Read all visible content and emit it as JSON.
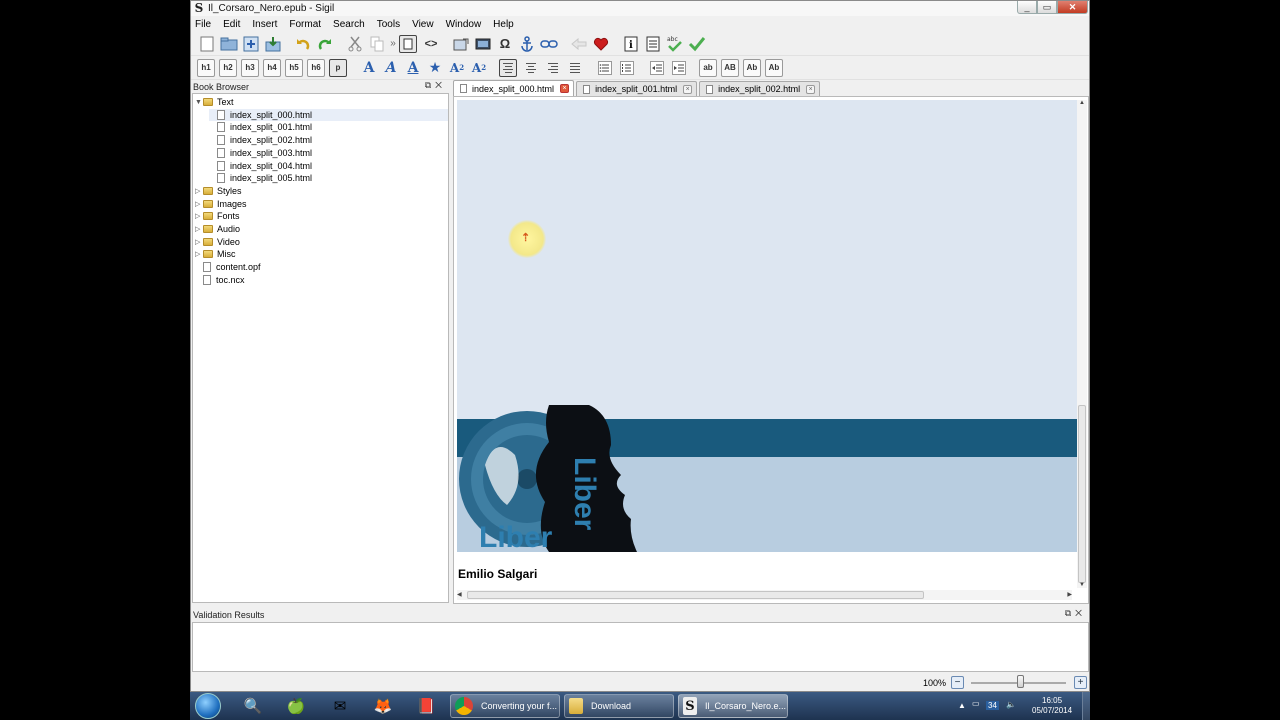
{
  "window": {
    "title": "Il_Corsaro_Nero.epub - Sigil",
    "controls": {
      "minimize": "_",
      "maximize": "▭",
      "close": "✕"
    }
  },
  "menu": [
    "File",
    "Edit",
    "Insert",
    "Format",
    "Search",
    "Tools",
    "View",
    "Window",
    "Help"
  ],
  "toolbar1": {
    "icons": [
      "new-file-icon",
      "open-folder-icon",
      "add-file-icon",
      "save-icon",
      "undo-icon",
      "redo-icon",
      "cut-icon",
      "copy-icon",
      "more-icon",
      "book-view-icon",
      "code-view-icon",
      "insert-image-icon",
      "screenshot-icon",
      "special-char-icon",
      "anchor-icon",
      "link-icon",
      "back-icon",
      "donate-heart-icon",
      "meta-info-icon",
      "toc-icon",
      "spellcheck-icon",
      "validate-check-icon"
    ],
    "omega": "Ω",
    "more": "»"
  },
  "toolbar2": {
    "headings": [
      "h1",
      "h2",
      "h3",
      "h4",
      "h5",
      "h6",
      "p"
    ],
    "case_buttons": [
      "ab",
      "AB",
      "Ab",
      "Ab"
    ]
  },
  "book_browser": {
    "title": "Book Browser",
    "tree": [
      {
        "label": "Text",
        "type": "folder",
        "expanded": true
      },
      {
        "label": "index_split_000.html",
        "type": "file",
        "selected": true
      },
      {
        "label": "index_split_001.html",
        "type": "file"
      },
      {
        "label": "index_split_002.html",
        "type": "file"
      },
      {
        "label": "index_split_003.html",
        "type": "file"
      },
      {
        "label": "index_split_004.html",
        "type": "file"
      },
      {
        "label": "index_split_005.html",
        "type": "file"
      },
      {
        "label": "Styles",
        "type": "folder"
      },
      {
        "label": "Images",
        "type": "folder"
      },
      {
        "label": "Fonts",
        "type": "folder"
      },
      {
        "label": "Audio",
        "type": "folder"
      },
      {
        "label": "Video",
        "type": "folder"
      },
      {
        "label": "Misc",
        "type": "folder"
      },
      {
        "label": "content.opf",
        "type": "file"
      },
      {
        "label": "toc.ncx",
        "type": "file"
      }
    ]
  },
  "tabs": [
    {
      "label": "index_split_000.html",
      "active": true
    },
    {
      "label": "index_split_001.html",
      "active": false
    },
    {
      "label": "index_split_002.html",
      "active": false
    }
  ],
  "editor": {
    "author": "Emilio Salgari",
    "cover_logo_text": "LiberLiber",
    "colors": {
      "page": "#dde6f1",
      "band_dark": "#195a7d",
      "band_light": "#b8cde0"
    }
  },
  "validation": {
    "title": "Validation Results"
  },
  "status": {
    "zoom": "100%",
    "zoom_out": "−",
    "zoom_in": "+",
    "zoom_level": 0.5
  },
  "taskbar": {
    "tasks": [
      {
        "label": "Converting your f...",
        "icon": "chrome-icon"
      },
      {
        "label": "Download",
        "icon": "folder-icon"
      },
      {
        "label": "Il_Corsaro_Nero.e...",
        "icon": "sigil-icon"
      }
    ],
    "clock_time": "16:05",
    "clock_date": "05/07/2014",
    "tray_number": "34"
  }
}
